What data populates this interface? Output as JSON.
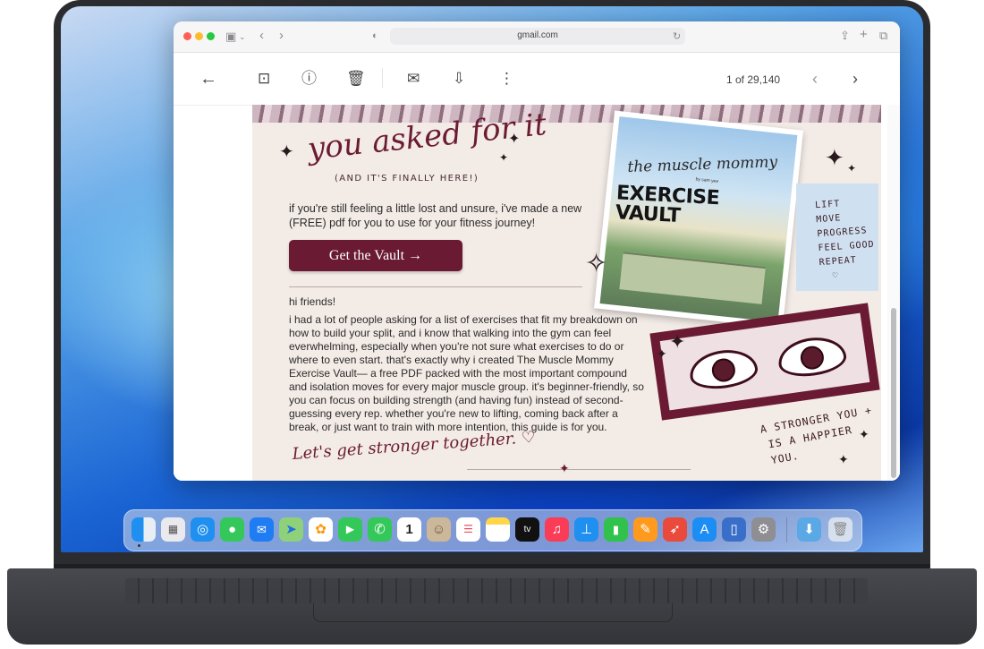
{
  "browser": {
    "address": "gmail.com",
    "traffic_lights": {
      "close": "#fe5f57",
      "minimize": "#febb2e",
      "zoom": "#28c840"
    }
  },
  "toolbar": {
    "pager_text": "1 of 29,140"
  },
  "email": {
    "headline": "you asked for it",
    "subheadline": "(AND IT'S FINALLY HERE!)",
    "intro": "if you're still feeling a little lost and unsure, i've made a new (FREE) pdf for you to use for your fitness journey!",
    "cta_label": "Get the Vault →",
    "greeting": "hi friends!",
    "body": "i had a lot of people asking for a list of exercises that fit my breakdown on how to build your split, and i know that walking into the gym can feel everwhelming, especially when you're not sure what exercises to do or where to even start. that's exactly why i created The Muscle Mommy Exercise Vault— a free PDF packed with the most important compound and isolation moves for every major muscle group. it's beginner-friendly, so you can focus on building strength (and having fun) instead of second-guessing every rep. whether you're new to lifting, coming back after a break, or just want to train with more intention, this guide is for you.",
    "signoff": "Let's get stronger together. ♡",
    "cover": {
      "script_title": "the muscle mommy",
      "title": "EXERCISE VAULT",
      "tiny_text": "by sam yee"
    },
    "side_words": [
      "LIFT",
      "MOVE",
      "PROGRESS",
      "FEEL GOOD",
      "REPEAT"
    ],
    "closing_line1": "A STRONGER YOU +",
    "closing_line2": "IS A HAPPIER YOU.",
    "accent_color": "#6a1a33"
  },
  "dock": {
    "apps": [
      "Finder",
      "Launchpad",
      "Safari",
      "Messages",
      "Mail",
      "Maps",
      "Photos",
      "FaceTime",
      "Phone",
      "Calendar",
      "Contacts",
      "Reminders",
      "Notes",
      "TV",
      "Music",
      "Keynote",
      "Numbers",
      "Pages",
      "Rocket",
      "App Store",
      "iPhone Mirroring",
      "System Settings",
      "Downloads",
      "Trash"
    ],
    "calendar_day": "1"
  }
}
